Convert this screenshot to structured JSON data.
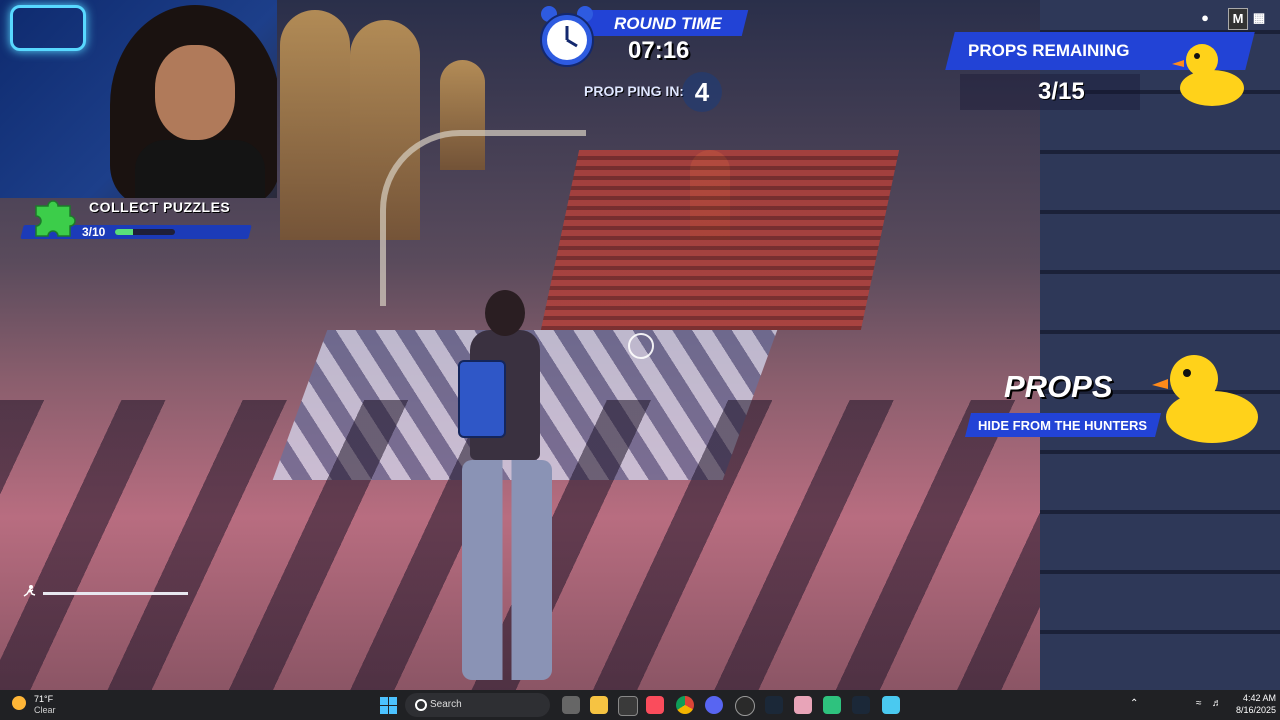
{
  "hud": {
    "collect_puzzles": {
      "title": "COLLECT PUZZLES",
      "count": "3/10",
      "progress": 0.3
    },
    "round_time": {
      "title": "ROUND TIME",
      "time": "07:16"
    },
    "prop_ping": {
      "label": "PROP PING IN:",
      "value": "4"
    },
    "props_remaining": {
      "title": "PROPS REMAINING",
      "count": "3/15"
    },
    "role": {
      "title": "PROPS",
      "subtitle": "HIDE FROM THE HUNTERS"
    },
    "top_icons": [
      "map-pin-icon",
      "M"
    ]
  },
  "colors": {
    "hud_blue": "#2243d6",
    "puzzle_green": "#3ccd4a",
    "duck_yellow": "#ffd21a"
  },
  "taskbar": {
    "weather": {
      "temp": "71°F",
      "condition": "Clear"
    },
    "search_label": "Search",
    "apps": [
      "file-explorer-icon",
      "store-icon",
      "music-icon",
      "chrome-icon",
      "discord-icon",
      "steam-icon",
      "app-icon",
      "steam-icon",
      "fortnite-icon"
    ],
    "time": "4:42 AM",
    "date": "8/16/2025"
  }
}
